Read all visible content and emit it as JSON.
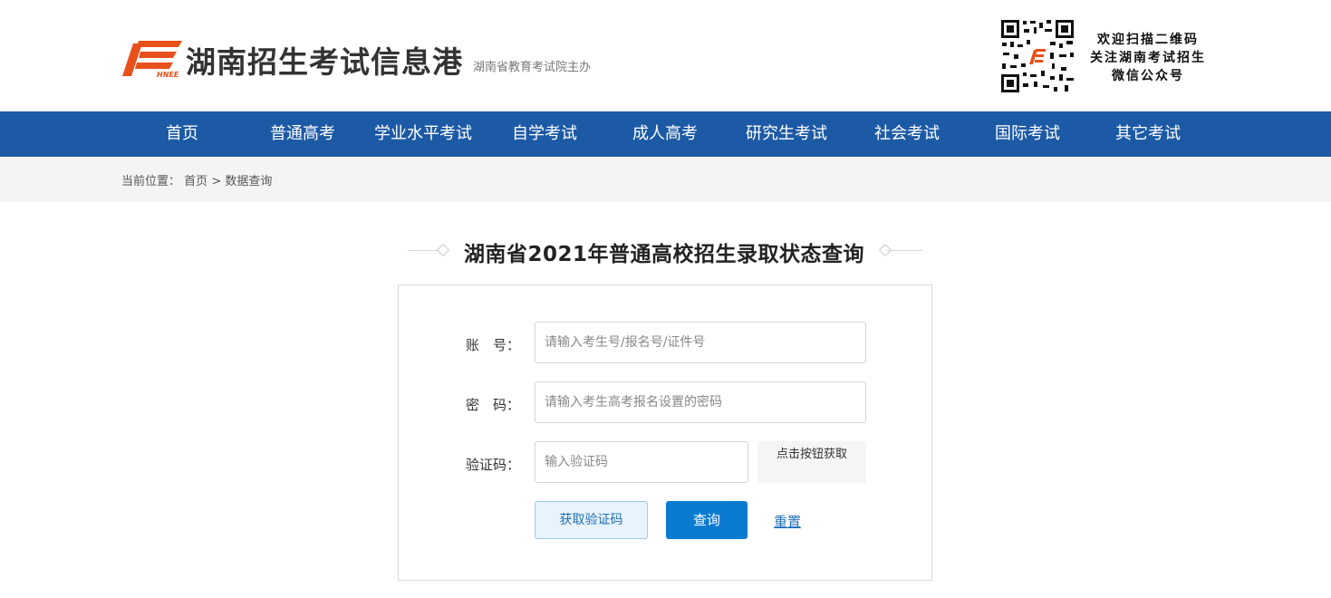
{
  "header": {
    "site_title": "湖南招生考试信息港",
    "site_subtitle": "湖南省教育考试院主办",
    "logo_small_text": "HNEE",
    "qr_text": [
      "欢迎扫描二维码",
      "关注湖南考试招生",
      "微信公众号"
    ]
  },
  "nav": {
    "items": [
      "首页",
      "普通高考",
      "学业水平考试",
      "自学考试",
      "成人高考",
      "研究生考试",
      "社会考试",
      "国际考试",
      "其它考试"
    ]
  },
  "breadcrumb": {
    "prefix": "当前位置：",
    "home": "首页",
    "separator": ">",
    "current": "数据查询"
  },
  "page_title": "湖南省2021年普通高校招生录取状态查询",
  "form": {
    "account_label": "账　号：",
    "account_placeholder": "请输入考生号/报名号/证件号",
    "password_label": "密　码：",
    "password_placeholder": "请输入考生高考报名设置的密码",
    "captcha_label": "验证码：",
    "captcha_placeholder": "输入验证码",
    "captcha_hint": "点击按钮获取",
    "get_code_button": "获取验证码",
    "query_button": "查询",
    "reset_link": "重置"
  },
  "colors": {
    "nav_bg": "#1d5aa5",
    "logo_orange": "#e8501c",
    "query_button": "#0b7bd1",
    "link_blue": "#1f6fb5"
  }
}
